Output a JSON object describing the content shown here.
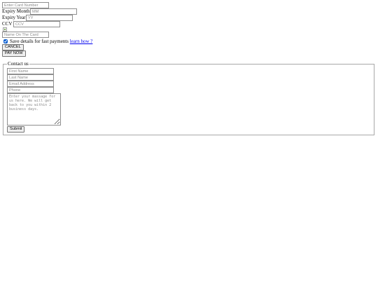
{
  "payment": {
    "card_number": {
      "placeholder": "Enter Card Number",
      "value": ""
    },
    "expiry_month": {
      "label": "Expiry Month",
      "placeholder": "MM",
      "value": ""
    },
    "expiry_year": {
      "label": "Expiry Year",
      "placeholder": "YY",
      "value": ""
    },
    "ccv": {
      "label": "CCV",
      "placeholder": "CCV",
      "value": ""
    },
    "name_on_card": {
      "placeholder": "Name On The Card",
      "value": ""
    },
    "save_details": {
      "label": "Save details for fast payments",
      "checked": true,
      "learn_link": "learn how ?"
    },
    "cancel_label": "CANCEL",
    "pay_label": "PAY NOW"
  },
  "contact": {
    "legend": "Contact us",
    "first_name": {
      "placeholder": "First Name",
      "value": ""
    },
    "last_name": {
      "placeholder": "Last Name",
      "value": ""
    },
    "email": {
      "placeholder": "Email Address",
      "value": ""
    },
    "phone": {
      "placeholder": "Phone",
      "value": ""
    },
    "message": {
      "placeholder": "Enter your massage for us here. We will get back to you within 2 business days.",
      "value": ""
    },
    "submit_label": "Submit"
  },
  "colors": {
    "link": "#0000ee",
    "checkbox_accent": "#0b5fd0"
  }
}
